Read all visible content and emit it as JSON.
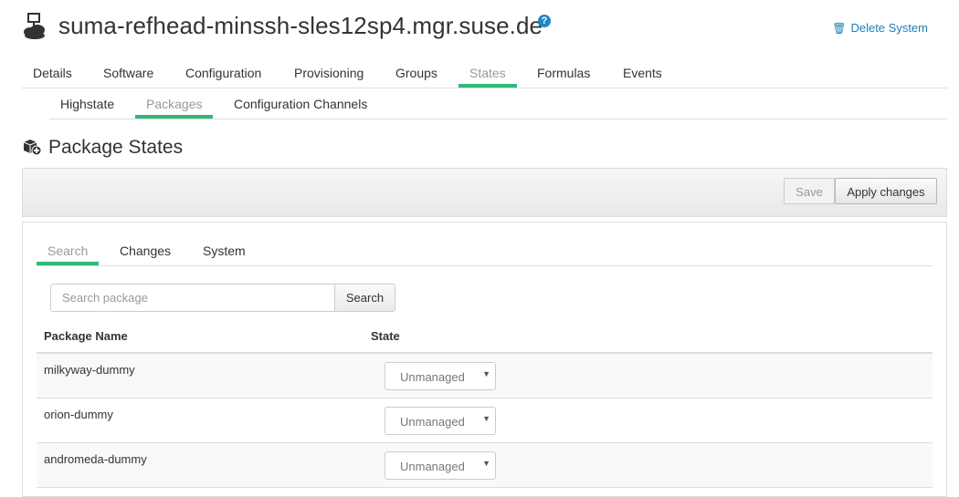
{
  "header": {
    "title": "suma-refhead-minssh-sles12sp4.mgr.suse.de",
    "help_label": "?",
    "delete_label": "Delete System",
    "icons": {
      "system": "system-icon",
      "help": "help-icon",
      "trash": "trash-icon"
    }
  },
  "main_tabs": [
    {
      "label": "Details",
      "active": false
    },
    {
      "label": "Software",
      "active": false
    },
    {
      "label": "Configuration",
      "active": false
    },
    {
      "label": "Provisioning",
      "active": false
    },
    {
      "label": "Groups",
      "active": false
    },
    {
      "label": "States",
      "active": true
    },
    {
      "label": "Formulas",
      "active": false
    },
    {
      "label": "Events",
      "active": false
    }
  ],
  "sub_tabs": [
    {
      "label": "Highstate",
      "active": false
    },
    {
      "label": "Packages",
      "active": true
    },
    {
      "label": "Configuration Channels",
      "active": false
    }
  ],
  "section": {
    "title": "Package States",
    "icon": "package-plus-icon"
  },
  "toolbar": {
    "save_label": "Save",
    "apply_label": "Apply changes"
  },
  "panel_tabs": [
    {
      "label": "Search",
      "active": true
    },
    {
      "label": "Changes",
      "active": false
    },
    {
      "label": "System",
      "active": false
    }
  ],
  "search": {
    "placeholder": "Search package",
    "button_label": "Search"
  },
  "table": {
    "columns": [
      "Package Name",
      "State"
    ],
    "rows": [
      {
        "name": "milkyway-dummy",
        "state": "Unmanaged"
      },
      {
        "name": "orion-dummy",
        "state": "Unmanaged"
      },
      {
        "name": "andromeda-dummy",
        "state": "Unmanaged"
      }
    ]
  },
  "colors": {
    "accent": "#30ba78",
    "link": "#1f7fb6",
    "help": "#1f87c7"
  }
}
